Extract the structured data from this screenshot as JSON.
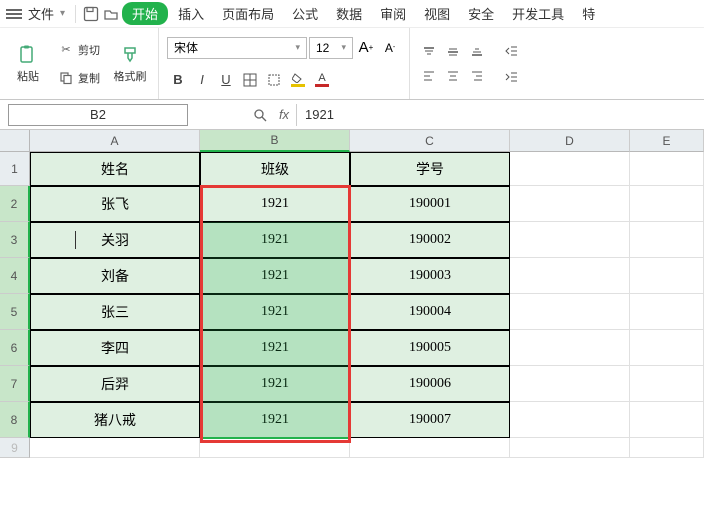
{
  "menubar": {
    "file_label": "文件",
    "tabs": [
      "开始",
      "插入",
      "页面布局",
      "公式",
      "数据",
      "审阅",
      "视图",
      "安全",
      "开发工具",
      "特"
    ]
  },
  "ribbon": {
    "paste_label": "粘贴",
    "cut_label": "剪切",
    "copy_label": "复制",
    "fmt_painter_label": "格式刷",
    "font_name": "宋体",
    "font_size": "12"
  },
  "formula_bar": {
    "cell_ref": "B2",
    "value": "1921"
  },
  "columns": [
    "A",
    "B",
    "C",
    "D",
    "E"
  ],
  "row_numbers": [
    "1",
    "2",
    "3",
    "4",
    "5",
    "6",
    "7",
    "8",
    "9"
  ],
  "table": {
    "headers": [
      "姓名",
      "班级",
      "学号"
    ],
    "rows": [
      [
        "张飞",
        "1921",
        "190001"
      ],
      [
        "关羽",
        "1921",
        "190002"
      ],
      [
        "刘备",
        "1921",
        "190003"
      ],
      [
        "张三",
        "1921",
        "190004"
      ],
      [
        "李四",
        "1921",
        "190005"
      ],
      [
        "后羿",
        "1921",
        "190006"
      ],
      [
        "猪八戒",
        "1921",
        "190007"
      ]
    ]
  }
}
